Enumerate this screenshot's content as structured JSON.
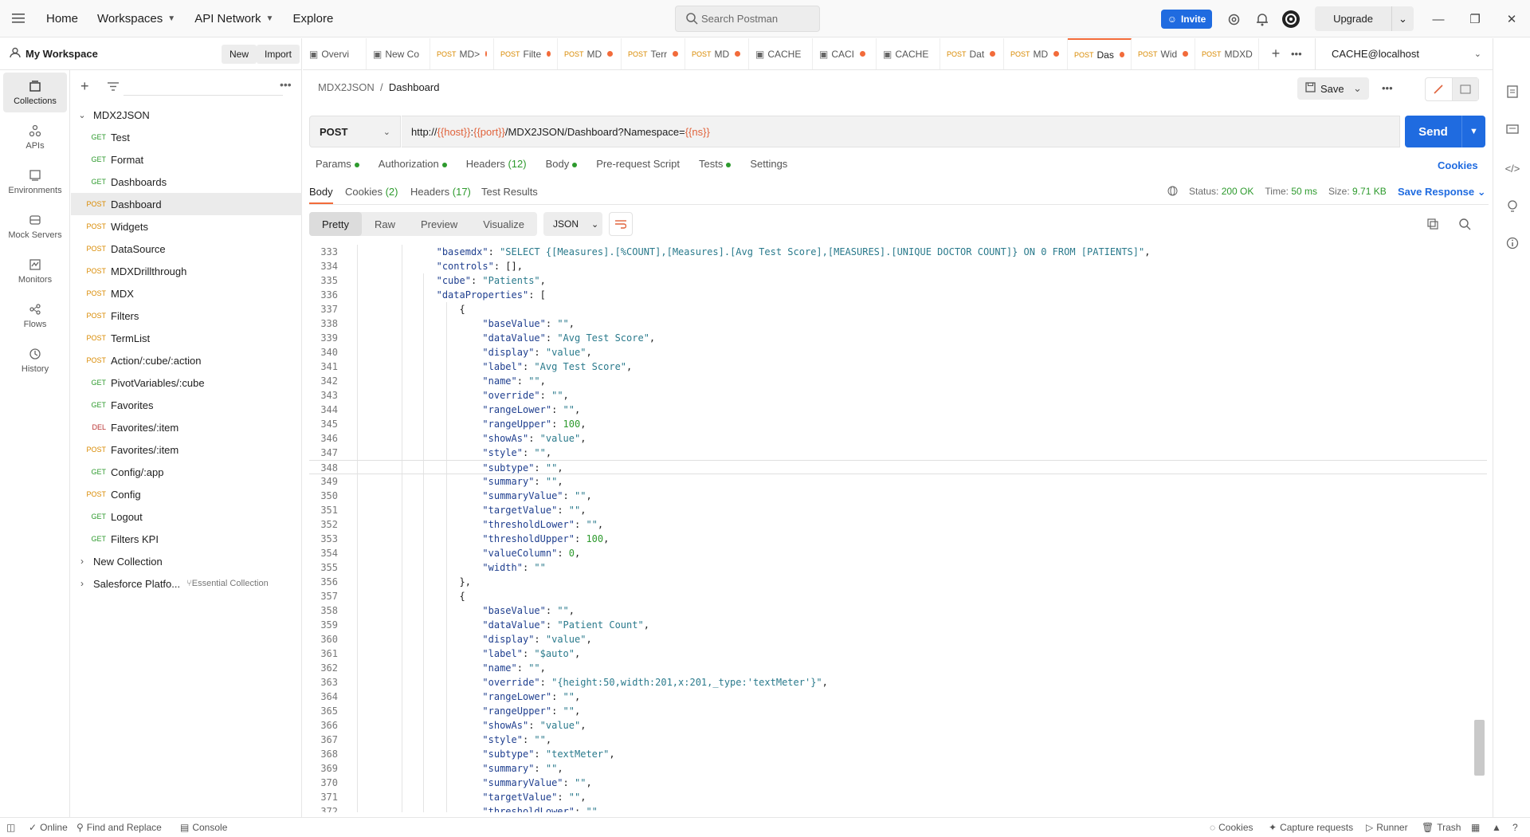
{
  "nav": {
    "home": "Home",
    "workspaces": "Workspaces",
    "api_network": "API Network",
    "explore": "Explore"
  },
  "search": {
    "placeholder": "Search Postman"
  },
  "topbar": {
    "invite": "Invite",
    "upgrade": "Upgrade"
  },
  "workspace": {
    "name": "My Workspace",
    "new": "New",
    "import": "Import"
  },
  "rail": [
    {
      "label": "Collections"
    },
    {
      "label": "APIs"
    },
    {
      "label": "Environments"
    },
    {
      "label": "Mock Servers"
    },
    {
      "label": "Monitors"
    },
    {
      "label": "Flows"
    },
    {
      "label": "History"
    }
  ],
  "tree": {
    "collection": "MDX2JSON",
    "items": [
      {
        "m": "GET",
        "label": "Test"
      },
      {
        "m": "GET",
        "label": "Format"
      },
      {
        "m": "GET",
        "label": "Dashboards"
      },
      {
        "m": "POST",
        "label": "Dashboard"
      },
      {
        "m": "POST",
        "label": "Widgets"
      },
      {
        "m": "POST",
        "label": "DataSource"
      },
      {
        "m": "POST",
        "label": "MDXDrillthrough"
      },
      {
        "m": "POST",
        "label": "MDX"
      },
      {
        "m": "POST",
        "label": "Filters"
      },
      {
        "m": "POST",
        "label": "TermList"
      },
      {
        "m": "POST",
        "label": "Action/:cube/:action"
      },
      {
        "m": "GET",
        "label": "PivotVariables/:cube"
      },
      {
        "m": "GET",
        "label": "Favorites"
      },
      {
        "m": "DEL",
        "label": "Favorites/:item"
      },
      {
        "m": "POST",
        "label": "Favorites/:item"
      },
      {
        "m": "GET",
        "label": "Config/:app"
      },
      {
        "m": "POST",
        "label": "Config"
      },
      {
        "m": "GET",
        "label": "Logout"
      },
      {
        "m": "GET",
        "label": "Filters KPI"
      }
    ],
    "other": [
      {
        "label": "New Collection"
      },
      {
        "label": "Salesforce Platfo...",
        "tag": "Essential Collection"
      }
    ]
  },
  "tabs": [
    {
      "m": "",
      "label": "Overvi"
    },
    {
      "m": "",
      "label": "New Co"
    },
    {
      "m": "POST",
      "label": "MD>"
    },
    {
      "m": "POST",
      "label": "Filte"
    },
    {
      "m": "POST",
      "label": "MD"
    },
    {
      "m": "POST",
      "label": "Terr"
    },
    {
      "m": "POST",
      "label": "MD"
    },
    {
      "m": "",
      "label": "CACHE"
    },
    {
      "m": "",
      "label": "CACI"
    },
    {
      "m": "",
      "label": "CACHE"
    },
    {
      "m": "POST",
      "label": "Dat"
    },
    {
      "m": "POST",
      "label": "MD"
    },
    {
      "m": "POST",
      "label": "Das"
    },
    {
      "m": "POST",
      "label": "Wid"
    },
    {
      "m": "POST",
      "label": "MDXD"
    }
  ],
  "env": "CACHE@localhost",
  "request": {
    "breadcrumb_parent": "MDX2JSON",
    "breadcrumb_name": "Dashboard",
    "save": "Save",
    "method": "POST",
    "url_pre": "http://",
    "url_host": "{{host}}",
    "url_sep": ":",
    "url_port": "{{port}}",
    "url_path": "/MDX2JSON/Dashboard?Namespace=",
    "url_ns": "{{ns}}",
    "send": "Send"
  },
  "reqtabs": {
    "params": "Params",
    "auth": "Authorization",
    "headers": "Headers",
    "headers_count": "(12)",
    "body": "Body",
    "prereq": "Pre-request Script",
    "tests": "Tests",
    "settings": "Settings",
    "cookies": "Cookies"
  },
  "response": {
    "body": "Body",
    "cookies": "Cookies",
    "cookies_count": "(2)",
    "headers": "Headers",
    "headers_count": "(17)",
    "tests": "Test Results",
    "status_label": "Status:",
    "status": "200 OK",
    "time_label": "Time:",
    "time": "50 ms",
    "size_label": "Size:",
    "size": "9.71 KB",
    "save": "Save Response",
    "views": [
      "Pretty",
      "Raw",
      "Preview",
      "Visualize"
    ],
    "format": "JSON"
  },
  "code": [
    {
      "n": "333",
      "t": "                \"basemdx\": \"SELECT {[Measures].[%COUNT],[Measures].[Avg Test Score],[MEASURES].[UNIQUE DOCTOR COUNT]} ON 0 FROM [PATIENTS]\","
    },
    {
      "n": "334",
      "t": "                \"controls\": [],"
    },
    {
      "n": "335",
      "t": "                \"cube\": \"Patients\","
    },
    {
      "n": "336",
      "t": "                \"dataProperties\": ["
    },
    {
      "n": "337",
      "t": "                    {"
    },
    {
      "n": "338",
      "t": "                        \"baseValue\": \"\","
    },
    {
      "n": "339",
      "t": "                        \"dataValue\": \"Avg Test Score\","
    },
    {
      "n": "340",
      "t": "                        \"display\": \"value\","
    },
    {
      "n": "341",
      "t": "                        \"label\": \"Avg Test Score\","
    },
    {
      "n": "342",
      "t": "                        \"name\": \"\","
    },
    {
      "n": "343",
      "t": "                        \"override\": \"\","
    },
    {
      "n": "344",
      "t": "                        \"rangeLower\": \"\","
    },
    {
      "n": "345",
      "t": "                        \"rangeUpper\": 100,"
    },
    {
      "n": "346",
      "t": "                        \"showAs\": \"value\","
    },
    {
      "n": "347",
      "t": "                        \"style\": \"\","
    },
    {
      "n": "348",
      "t": "                        \"subtype\": \"\","
    },
    {
      "n": "349",
      "t": "                        \"summary\": \"\","
    },
    {
      "n": "350",
      "t": "                        \"summaryValue\": \"\","
    },
    {
      "n": "351",
      "t": "                        \"targetValue\": \"\","
    },
    {
      "n": "352",
      "t": "                        \"thresholdLower\": \"\","
    },
    {
      "n": "353",
      "t": "                        \"thresholdUpper\": 100,"
    },
    {
      "n": "354",
      "t": "                        \"valueColumn\": 0,"
    },
    {
      "n": "355",
      "t": "                        \"width\": \"\""
    },
    {
      "n": "356",
      "t": "                    },"
    },
    {
      "n": "357",
      "t": "                    {"
    },
    {
      "n": "358",
      "t": "                        \"baseValue\": \"\","
    },
    {
      "n": "359",
      "t": "                        \"dataValue\": \"Patient Count\","
    },
    {
      "n": "360",
      "t": "                        \"display\": \"value\","
    },
    {
      "n": "361",
      "t": "                        \"label\": \"$auto\","
    },
    {
      "n": "362",
      "t": "                        \"name\": \"\","
    },
    {
      "n": "363",
      "t": "                        \"override\": \"{height:50,width:201,x:201,_type:'textMeter'}\","
    },
    {
      "n": "364",
      "t": "                        \"rangeLower\": \"\","
    },
    {
      "n": "365",
      "t": "                        \"rangeUpper\": \"\","
    },
    {
      "n": "366",
      "t": "                        \"showAs\": \"value\","
    },
    {
      "n": "367",
      "t": "                        \"style\": \"\","
    },
    {
      "n": "368",
      "t": "                        \"subtype\": \"textMeter\","
    },
    {
      "n": "369",
      "t": "                        \"summary\": \"\","
    },
    {
      "n": "370",
      "t": "                        \"summaryValue\": \"\","
    },
    {
      "n": "371",
      "t": "                        \"targetValue\": \"\","
    },
    {
      "n": "372",
      "t": "                        \"thresholdLower\": \"\","
    }
  ],
  "statusbar": {
    "online": "Online",
    "find": "Find and Replace",
    "console": "Console",
    "cookies": "Cookies",
    "capture": "Capture requests",
    "runner": "Runner",
    "trash": "Trash"
  }
}
